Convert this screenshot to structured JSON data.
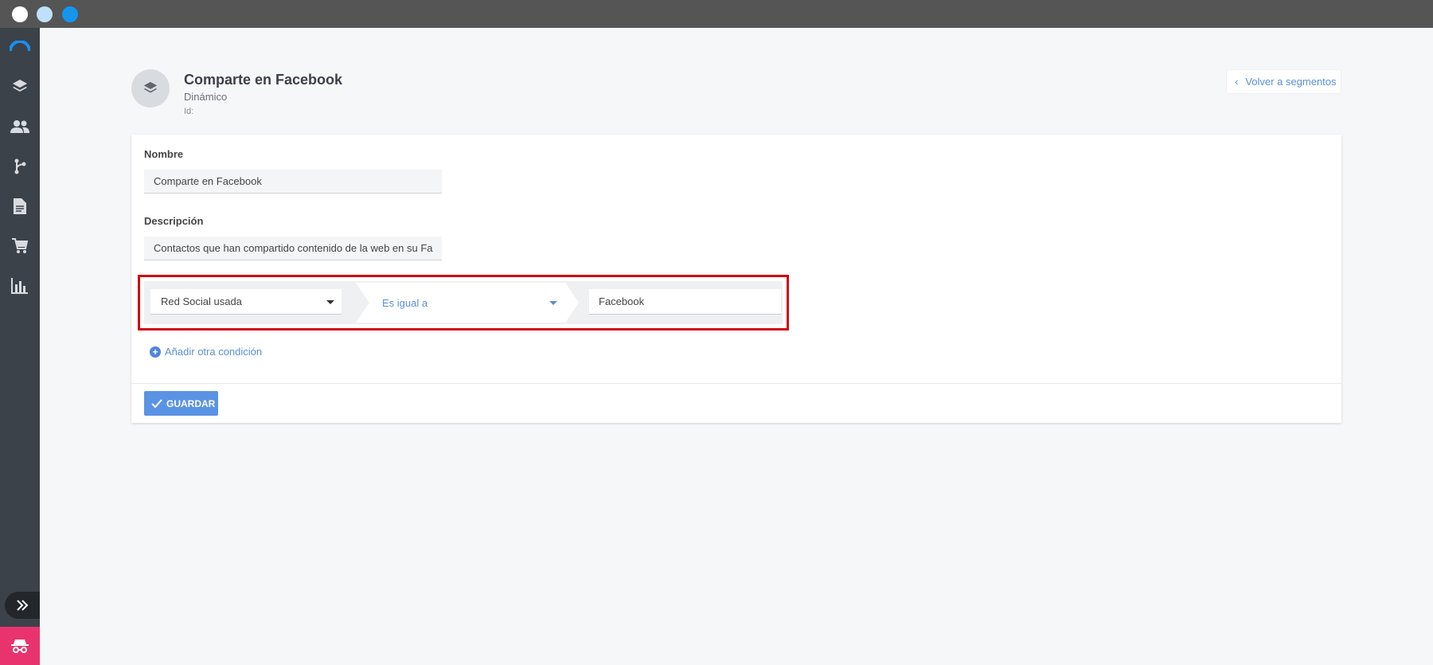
{
  "window": {
    "controls": [
      "close",
      "minimize",
      "maximize"
    ]
  },
  "sidebar": {
    "items": [
      {
        "icon": "layers-icon"
      },
      {
        "icon": "contacts-icon"
      },
      {
        "icon": "flow-icon"
      },
      {
        "icon": "document-icon"
      },
      {
        "icon": "cart-icon"
      },
      {
        "icon": "chart-icon"
      }
    ],
    "expand_icon": "double-chevron-right-icon",
    "incognito_icon": "incognito-icon",
    "colors": {
      "bg": "#3b4249",
      "accent": "#e8336f"
    }
  },
  "header": {
    "title": "Comparte en Facebook",
    "type": "Dinámico",
    "id_label": "Id:",
    "back_label": "Volver a segmentos"
  },
  "form": {
    "name_label": "Nombre",
    "name_value": "Comparte en Facebook",
    "description_label": "Descripción",
    "description_value": "Contactos que han compartido contenido de la web en su Fa",
    "condition": {
      "field": "Red Social usada",
      "operator": "Es igual a",
      "value": "Facebook"
    },
    "add_condition_label": "Añadir otra condición",
    "save_label": "GUARDAR"
  },
  "colors": {
    "primary": "#5b93e4",
    "link": "#5a8fd6",
    "highlight": "#d0060f"
  }
}
